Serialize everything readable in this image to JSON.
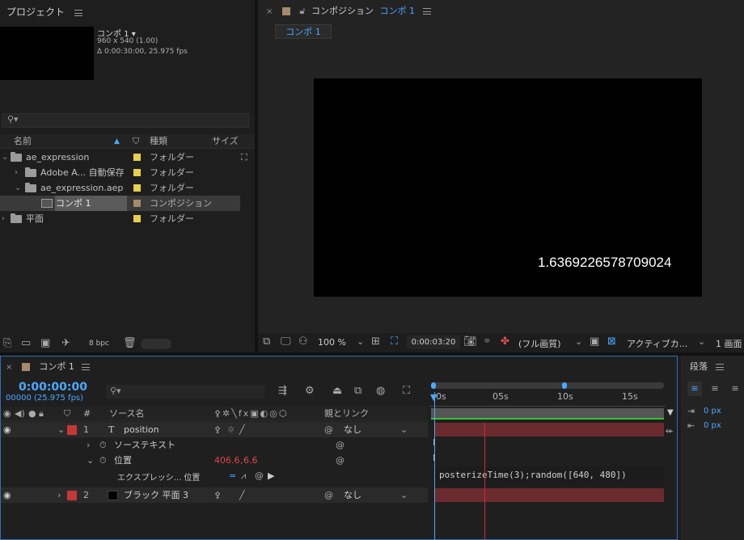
{
  "project": {
    "title": "プロジェクト",
    "comp_name": "コンポ 1 ▾",
    "comp_size": "960 x 540 (1.00)",
    "comp_duration": "Δ 0:00:30:00, 25.975 fps",
    "search_placeholder": "",
    "col_name": "名前",
    "col_type": "種類",
    "col_size": "サイズ",
    "items": [
      {
        "name": "ae_expression",
        "type": "フォルダー"
      },
      {
        "name": "Adobe A... 自動保存",
        "type": "フォルダー"
      },
      {
        "name": "ae_expression.aep",
        "type": "フォルダー"
      },
      {
        "name": "コンポ 1",
        "type": "コンポジション"
      },
      {
        "name": "平面",
        "type": "フォルダー"
      }
    ],
    "bpc": "8 bpc"
  },
  "comp_viewer": {
    "title_prefix": "コンポジション",
    "title_name": "コンポ 1",
    "tab": "コンポ 1",
    "canvas_text": "1.6369226578709024",
    "zoom": "100 %",
    "timecode": "0:00:03:20",
    "quality": "(フル画質)",
    "camera": "アクティブカ...",
    "views": "1 画面"
  },
  "timeline": {
    "tab": "コンポ 1",
    "current_time": "0:00:00:00",
    "frame_info": "00000 (25.975 fps)",
    "col_num": "#",
    "col_source": "ソース名",
    "col_parent": "親とリンク",
    "ruler": [
      "0s",
      "05s",
      "10s",
      "15s"
    ],
    "layers": [
      {
        "num": "1",
        "name": "position",
        "parent": "なし"
      },
      {
        "num": "2",
        "name": "ブラック 平面 3",
        "parent": "なし"
      }
    ],
    "prop_source_text": "ソーステキスト",
    "prop_position": "位置",
    "position_value_x": "406.6",
    "position_value_y": "6.6",
    "expression_label": "エクスプレッシ... 位置",
    "expression_code": "posterizeTime(3);random([640, 480])"
  },
  "paragraph": {
    "title": "段落",
    "indent1": "0 px",
    "indent2": "0 px"
  },
  "colors": {
    "accent": "#4aa8ff",
    "layer_label_red": "#c83737",
    "layer_bar": "#6b2a2d",
    "folder_label_yellow": "#e8d04a",
    "comp_label_tan": "#a58a6b"
  }
}
